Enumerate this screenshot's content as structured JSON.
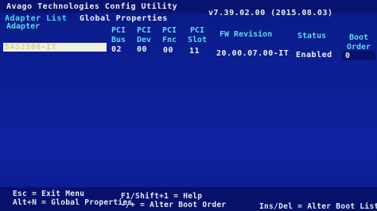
{
  "header": {
    "app_title": "Avago Technologies Config Utility",
    "version": "v7.39.02.00 (2015.08.03)"
  },
  "menu": {
    "adapter_list": "Adapter List",
    "global_properties": "Global Properties"
  },
  "table": {
    "columns": {
      "adapter": "Adapter",
      "pci_bus": "PCI\nBus",
      "pci_dev": "PCI\nDev",
      "pci_fnc": "PCI\nFnc",
      "pci_slot": "PCI\nSlot",
      "fw_revision": "FW Revision",
      "status": "Status",
      "boot_order": "Boot\nOrder"
    },
    "rows": [
      {
        "adapter": "SAS2308-IT",
        "pci_bus": "02",
        "pci_dev": "00",
        "pci_fnc": "00",
        "pci_slot": "11",
        "fw_revision": "20.00.07.00-IT",
        "status": "Enabled",
        "boot_order": "0"
      }
    ]
  },
  "footer": {
    "esc": "Esc = Exit Menu",
    "f1": "F1/Shift+1 = Help",
    "alt_n": "Alt+N = Global Properties",
    "alter_boot_order": "-/+ = Alter Boot Order",
    "ins_del": "Ins/Del = Alter Boot List"
  },
  "colors": {
    "background": "#0c2096",
    "header_cyan": "#5fd8e9",
    "text_white": "#eef1f5",
    "selection_bar": "#eef0e4"
  }
}
